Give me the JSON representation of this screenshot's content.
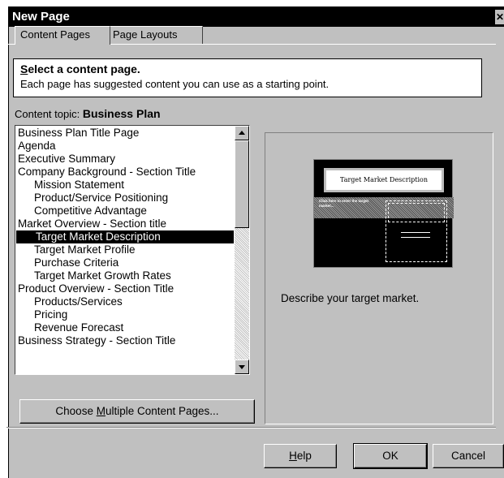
{
  "window": {
    "title": "New Page",
    "close_glyph": "✕"
  },
  "tabs": [
    {
      "label": "Content Pages",
      "active": true
    },
    {
      "label": "Page Layouts",
      "active": false
    }
  ],
  "header": {
    "title_first_letter": "S",
    "title_rest": "elect a content page.",
    "subtitle": "Each page has suggested content you can use as a starting point."
  },
  "topic": {
    "label": "Content topic:",
    "value": "Business Plan"
  },
  "content_list": {
    "items": [
      {
        "label": "Business Plan Title Page",
        "indent": false,
        "selected": false
      },
      {
        "label": "Agenda",
        "indent": false,
        "selected": false
      },
      {
        "label": "Executive Summary",
        "indent": false,
        "selected": false
      },
      {
        "label": "Company Background - Section Title",
        "indent": false,
        "selected": false
      },
      {
        "label": "Mission Statement",
        "indent": true,
        "selected": false
      },
      {
        "label": "Product/Service Positioning",
        "indent": true,
        "selected": false
      },
      {
        "label": "Competitive Advantage",
        "indent": true,
        "selected": false
      },
      {
        "label": "Market Overview - Section title",
        "indent": false,
        "selected": false
      },
      {
        "label": "Target Market Description",
        "indent": true,
        "selected": true
      },
      {
        "label": "Target Market Profile",
        "indent": true,
        "selected": false
      },
      {
        "label": "Purchase Criteria",
        "indent": true,
        "selected": false
      },
      {
        "label": "Target Market Growth Rates",
        "indent": true,
        "selected": false
      },
      {
        "label": "Product Overview - Section Title",
        "indent": false,
        "selected": false
      },
      {
        "label": "Products/Services",
        "indent": true,
        "selected": false
      },
      {
        "label": "Pricing",
        "indent": true,
        "selected": false
      },
      {
        "label": "Revenue Forecast",
        "indent": true,
        "selected": false
      },
      {
        "label": "Business Strategy - Section Title",
        "indent": false,
        "selected": false
      }
    ]
  },
  "buttons": {
    "choose_multiple_pre": "Choose ",
    "choose_multiple_key": "M",
    "choose_multiple_post": "ultiple Content Pages...",
    "help_key": "H",
    "help_rest": "elp",
    "ok": "OK",
    "cancel": "Cancel"
  },
  "preview": {
    "thumbnail_title": "Target Market Description",
    "thumbnail_text": "Click here to enter the target market...",
    "description": "Describe your target market."
  }
}
